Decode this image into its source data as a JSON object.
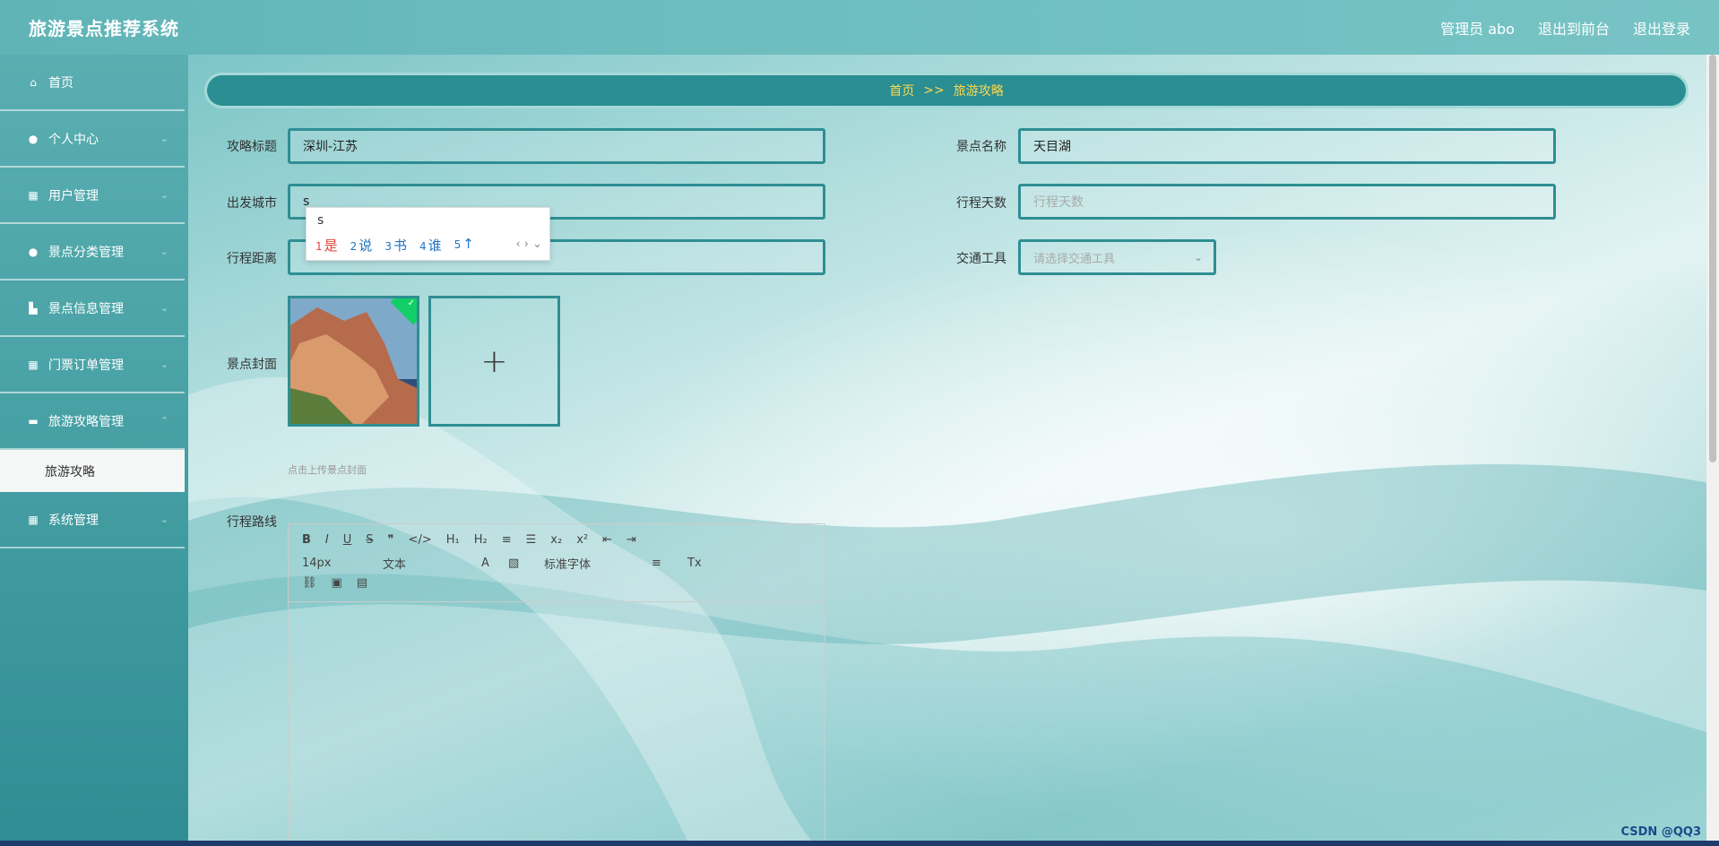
{
  "app": {
    "title": "旅游景点推荐系统"
  },
  "header": {
    "admin_label": "管理员 abo",
    "back_to_front": "退出到前台",
    "logout": "退出登录"
  },
  "sidebar": {
    "items": [
      {
        "label": "首页",
        "icon": "home-icon"
      },
      {
        "label": "个人中心",
        "icon": "user-icon"
      },
      {
        "label": "用户管理",
        "icon": "grid-icon"
      },
      {
        "label": "景点分类管理",
        "icon": "location-icon"
      },
      {
        "label": "景点信息管理",
        "icon": "building-icon"
      },
      {
        "label": "门票订单管理",
        "icon": "grid-icon"
      },
      {
        "label": "旅游攻略管理",
        "icon": "book-icon"
      },
      {
        "label": "系统管理",
        "icon": "grid-icon"
      }
    ],
    "sub_item": "旅游攻略"
  },
  "breadcrumb": {
    "home": "首页",
    "sep": ">>",
    "current": "旅游攻略"
  },
  "form": {
    "title_label": "攻略标题",
    "title_value": "深圳-江苏",
    "spot_label": "景点名称",
    "spot_value": "天目湖",
    "city_label": "出发城市",
    "city_value": "s",
    "days_label": "行程天数",
    "days_placeholder": "行程天数",
    "distance_label": "行程距离",
    "transport_label": "交通工具",
    "transport_placeholder": "请选择交通工具",
    "cover_label": "景点封面",
    "cover_hint": "点击上传景点封面",
    "route_label": "行程路线"
  },
  "ime": {
    "typed": "s",
    "candidates": [
      {
        "n": "1",
        "w": "是"
      },
      {
        "n": "2",
        "w": "说"
      },
      {
        "n": "3",
        "w": "书"
      },
      {
        "n": "4",
        "w": "谁"
      },
      {
        "n": "5",
        "w": "↑"
      }
    ]
  },
  "editor": {
    "font_size": "14px",
    "block": "文本",
    "font_family": "标准字体"
  },
  "watermark": "CSDN @QQ3"
}
